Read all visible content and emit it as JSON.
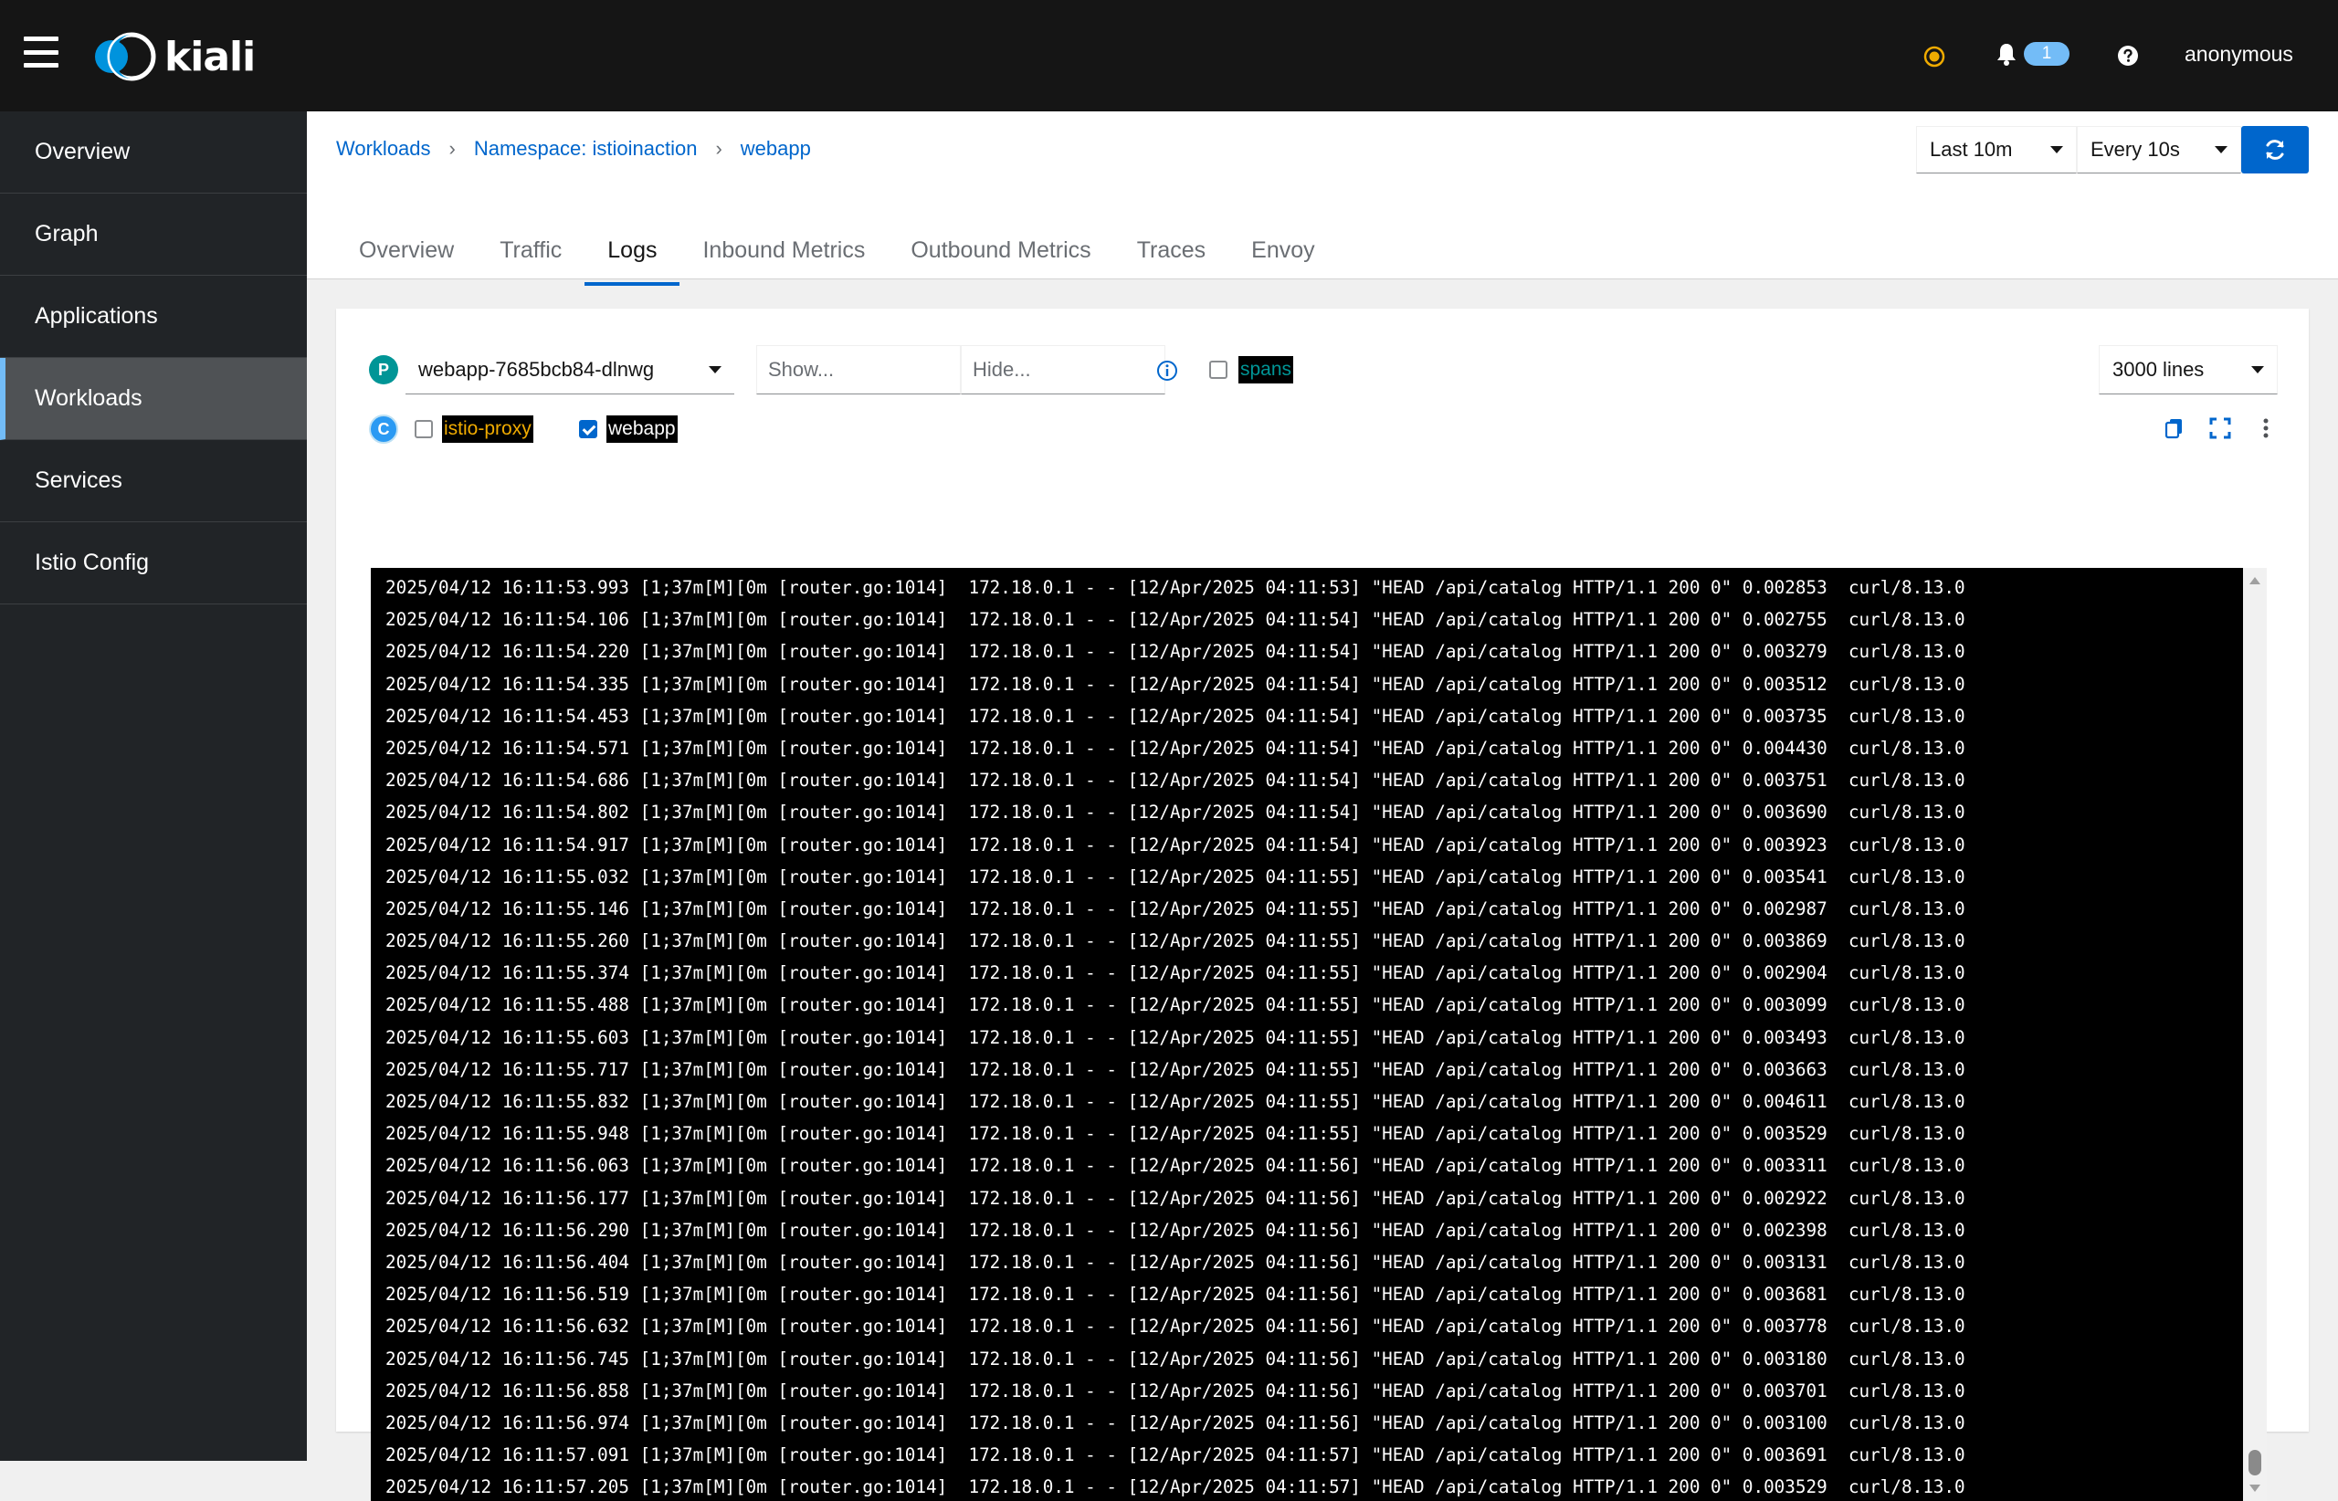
{
  "masthead": {
    "brand": "kiali",
    "notifications_count": "1",
    "user": "anonymous",
    "icons": [
      "menu-icon",
      "status-warning-icon",
      "bell-icon",
      "help-icon"
    ]
  },
  "sidebar": {
    "items": [
      {
        "label": "Overview"
      },
      {
        "label": "Graph"
      },
      {
        "label": "Applications"
      },
      {
        "label": "Workloads",
        "active": true
      },
      {
        "label": "Services"
      },
      {
        "label": "Istio Config"
      }
    ]
  },
  "breadcrumb": {
    "items": [
      "Workloads",
      "Namespace: istioinaction",
      "webapp"
    ]
  },
  "toolbar": {
    "time_range": "Last 10m",
    "refresh_interval": "Every 10s"
  },
  "tabs": [
    {
      "label": "Overview"
    },
    {
      "label": "Traffic"
    },
    {
      "label": "Logs",
      "active": true
    },
    {
      "label": "Inbound Metrics"
    },
    {
      "label": "Outbound Metrics"
    },
    {
      "label": "Traces"
    },
    {
      "label": "Envoy"
    }
  ],
  "logs": {
    "pod_badge": "P",
    "pod": "webapp-7685bcb84-dlnwg",
    "show_placeholder": "Show...",
    "hide_placeholder": "Hide...",
    "spans_label": "spans",
    "spans_checked": false,
    "lines_option": "3000 lines",
    "container_badge": "C",
    "containers": [
      {
        "name": "istio-proxy",
        "checked": false,
        "color": "#f0ab00"
      },
      {
        "name": "webapp",
        "checked": true,
        "color": "#ffffff"
      }
    ],
    "spans_color": "#009596",
    "lines": [
      "2025/04/12 16:11:53.993 \u001f[1;37m[M]\u001f[0m [router.go:1014]  172.18.0.1 - - [12/Apr/2025 04:11:53] \"HEAD /api/catalog HTTP/1.1 200 0\" 0.002853  curl/8.13.0",
      "2025/04/12 16:11:54.106 \u001f[1;37m[M]\u001f[0m [router.go:1014]  172.18.0.1 - - [12/Apr/2025 04:11:54] \"HEAD /api/catalog HTTP/1.1 200 0\" 0.002755  curl/8.13.0",
      "2025/04/12 16:11:54.220 \u001f[1;37m[M]\u001f[0m [router.go:1014]  172.18.0.1 - - [12/Apr/2025 04:11:54] \"HEAD /api/catalog HTTP/1.1 200 0\" 0.003279  curl/8.13.0",
      "2025/04/12 16:11:54.335 \u001f[1;37m[M]\u001f[0m [router.go:1014]  172.18.0.1 - - [12/Apr/2025 04:11:54] \"HEAD /api/catalog HTTP/1.1 200 0\" 0.003512  curl/8.13.0",
      "2025/04/12 16:11:54.453 \u001f[1;37m[M]\u001f[0m [router.go:1014]  172.18.0.1 - - [12/Apr/2025 04:11:54] \"HEAD /api/catalog HTTP/1.1 200 0\" 0.003735  curl/8.13.0",
      "2025/04/12 16:11:54.571 \u001f[1;37m[M]\u001f[0m [router.go:1014]  172.18.0.1 - - [12/Apr/2025 04:11:54] \"HEAD /api/catalog HTTP/1.1 200 0\" 0.004430  curl/8.13.0",
      "2025/04/12 16:11:54.686 \u001f[1;37m[M]\u001f[0m [router.go:1014]  172.18.0.1 - - [12/Apr/2025 04:11:54] \"HEAD /api/catalog HTTP/1.1 200 0\" 0.003751  curl/8.13.0",
      "2025/04/12 16:11:54.802 \u001f[1;37m[M]\u001f[0m [router.go:1014]  172.18.0.1 - - [12/Apr/2025 04:11:54] \"HEAD /api/catalog HTTP/1.1 200 0\" 0.003690  curl/8.13.0",
      "2025/04/12 16:11:54.917 \u001f[1;37m[M]\u001f[0m [router.go:1014]  172.18.0.1 - - [12/Apr/2025 04:11:54] \"HEAD /api/catalog HTTP/1.1 200 0\" 0.003923  curl/8.13.0",
      "2025/04/12 16:11:55.032 \u001f[1;37m[M]\u001f[0m [router.go:1014]  172.18.0.1 - - [12/Apr/2025 04:11:55] \"HEAD /api/catalog HTTP/1.1 200 0\" 0.003541  curl/8.13.0",
      "2025/04/12 16:11:55.146 \u001f[1;37m[M]\u001f[0m [router.go:1014]  172.18.0.1 - - [12/Apr/2025 04:11:55] \"HEAD /api/catalog HTTP/1.1 200 0\" 0.002987  curl/8.13.0",
      "2025/04/12 16:11:55.260 \u001f[1;37m[M]\u001f[0m [router.go:1014]  172.18.0.1 - - [12/Apr/2025 04:11:55] \"HEAD /api/catalog HTTP/1.1 200 0\" 0.003869  curl/8.13.0",
      "2025/04/12 16:11:55.374 \u001f[1;37m[M]\u001f[0m [router.go:1014]  172.18.0.1 - - [12/Apr/2025 04:11:55] \"HEAD /api/catalog HTTP/1.1 200 0\" 0.002904  curl/8.13.0",
      "2025/04/12 16:11:55.488 \u001f[1;37m[M]\u001f[0m [router.go:1014]  172.18.0.1 - - [12/Apr/2025 04:11:55] \"HEAD /api/catalog HTTP/1.1 200 0\" 0.003099  curl/8.13.0",
      "2025/04/12 16:11:55.603 \u001f[1;37m[M]\u001f[0m [router.go:1014]  172.18.0.1 - - [12/Apr/2025 04:11:55] \"HEAD /api/catalog HTTP/1.1 200 0\" 0.003493  curl/8.13.0",
      "2025/04/12 16:11:55.717 \u001f[1;37m[M]\u001f[0m [router.go:1014]  172.18.0.1 - - [12/Apr/2025 04:11:55] \"HEAD /api/catalog HTTP/1.1 200 0\" 0.003663  curl/8.13.0",
      "2025/04/12 16:11:55.832 \u001f[1;37m[M]\u001f[0m [router.go:1014]  172.18.0.1 - - [12/Apr/2025 04:11:55] \"HEAD /api/catalog HTTP/1.1 200 0\" 0.004611  curl/8.13.0",
      "2025/04/12 16:11:55.948 \u001f[1;37m[M]\u001f[0m [router.go:1014]  172.18.0.1 - - [12/Apr/2025 04:11:55] \"HEAD /api/catalog HTTP/1.1 200 0\" 0.003529  curl/8.13.0",
      "2025/04/12 16:11:56.063 \u001f[1;37m[M]\u001f[0m [router.go:1014]  172.18.0.1 - - [12/Apr/2025 04:11:56] \"HEAD /api/catalog HTTP/1.1 200 0\" 0.003311  curl/8.13.0",
      "2025/04/12 16:11:56.177 \u001f[1;37m[M]\u001f[0m [router.go:1014]  172.18.0.1 - - [12/Apr/2025 04:11:56] \"HEAD /api/catalog HTTP/1.1 200 0\" 0.002922  curl/8.13.0",
      "2025/04/12 16:11:56.290 \u001f[1;37m[M]\u001f[0m [router.go:1014]  172.18.0.1 - - [12/Apr/2025 04:11:56] \"HEAD /api/catalog HTTP/1.1 200 0\" 0.002398  curl/8.13.0",
      "2025/04/12 16:11:56.404 \u001f[1;37m[M]\u001f[0m [router.go:1014]  172.18.0.1 - - [12/Apr/2025 04:11:56] \"HEAD /api/catalog HTTP/1.1 200 0\" 0.003131  curl/8.13.0",
      "2025/04/12 16:11:56.519 \u001f[1;37m[M]\u001f[0m [router.go:1014]  172.18.0.1 - - [12/Apr/2025 04:11:56] \"HEAD /api/catalog HTTP/1.1 200 0\" 0.003681  curl/8.13.0",
      "2025/04/12 16:11:56.632 \u001f[1;37m[M]\u001f[0m [router.go:1014]  172.18.0.1 - - [12/Apr/2025 04:11:56] \"HEAD /api/catalog HTTP/1.1 200 0\" 0.003778  curl/8.13.0",
      "2025/04/12 16:11:56.745 \u001f[1;37m[M]\u001f[0m [router.go:1014]  172.18.0.1 - - [12/Apr/2025 04:11:56] \"HEAD /api/catalog HTTP/1.1 200 0\" 0.003180  curl/8.13.0",
      "2025/04/12 16:11:56.858 \u001f[1;37m[M]\u001f[0m [router.go:1014]  172.18.0.1 - - [12/Apr/2025 04:11:56] \"HEAD /api/catalog HTTP/1.1 200 0\" 0.003701  curl/8.13.0",
      "2025/04/12 16:11:56.974 \u001f[1;37m[M]\u001f[0m [router.go:1014]  172.18.0.1 - - [12/Apr/2025 04:11:56] \"HEAD /api/catalog HTTP/1.1 200 0\" 0.003100  curl/8.13.0",
      "2025/04/12 16:11:57.091 \u001f[1;37m[M]\u001f[0m [router.go:1014]  172.18.0.1 - - [12/Apr/2025 04:11:57] \"HEAD /api/catalog HTTP/1.1 200 0\" 0.003691  curl/8.13.0",
      "2025/04/12 16:11:57.205 \u001f[1;37m[M]\u001f[0m [router.go:1014]  172.18.0.1 - - [12/Apr/2025 04:11:57] \"HEAD /api/catalog HTTP/1.1 200 0\" 0.003529  curl/8.13.0"
    ]
  }
}
